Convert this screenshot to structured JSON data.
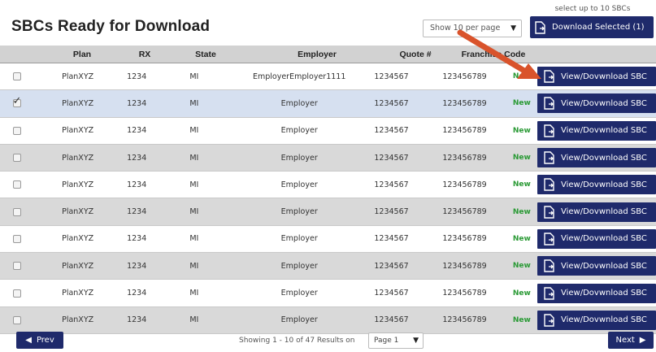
{
  "header": {
    "title": "SBCs Ready for Download",
    "per_page": "Show 10 per page",
    "hint": "select up to 10 SBCs",
    "download_selected": "Download Selected (1)"
  },
  "table": {
    "columns": [
      "Plan",
      "RX",
      "State",
      "Employer",
      "Quote #",
      "Franchise Code"
    ],
    "rows": [
      {
        "checked": false,
        "plan": "PlanXYZ",
        "rx": "1234",
        "state": "MI",
        "employer": "EmployerEmployer1111",
        "quote": "1234567",
        "franchise": "123456789",
        "badge": "New",
        "action": "View/Dovwnload SBC"
      },
      {
        "checked": true,
        "plan": "PlanXYZ",
        "rx": "1234",
        "state": "MI",
        "employer": "Employer",
        "quote": "1234567",
        "franchise": "123456789",
        "badge": "New",
        "action": "View/Dovwnload SBC"
      },
      {
        "checked": false,
        "plan": "PlanXYZ",
        "rx": "1234",
        "state": "MI",
        "employer": "Employer",
        "quote": "1234567",
        "franchise": "123456789",
        "badge": "New",
        "action": "View/Dovwnload SBC"
      },
      {
        "checked": false,
        "plan": "PlanXYZ",
        "rx": "1234",
        "state": "MI",
        "employer": "Employer",
        "quote": "1234567",
        "franchise": "123456789",
        "badge": "New",
        "action": "View/Dovwnload SBC"
      },
      {
        "checked": false,
        "plan": "PlanXYZ",
        "rx": "1234",
        "state": "MI",
        "employer": "Employer",
        "quote": "1234567",
        "franchise": "123456789",
        "badge": "New",
        "action": "View/Dovwnload SBC"
      },
      {
        "checked": false,
        "plan": "PlanXYZ",
        "rx": "1234",
        "state": "MI",
        "employer": "Employer",
        "quote": "1234567",
        "franchise": "123456789",
        "badge": "New",
        "action": "View/Dovwnload SBC"
      },
      {
        "checked": false,
        "plan": "PlanXYZ",
        "rx": "1234",
        "state": "MI",
        "employer": "Employer",
        "quote": "1234567",
        "franchise": "123456789",
        "badge": "New",
        "action": "View/Dovwnload SBC"
      },
      {
        "checked": false,
        "plan": "PlanXYZ",
        "rx": "1234",
        "state": "MI",
        "employer": "Employer",
        "quote": "1234567",
        "franchise": "123456789",
        "badge": "New",
        "action": "View/Dovwnload SBC"
      },
      {
        "checked": false,
        "plan": "PlanXYZ",
        "rx": "1234",
        "state": "MI",
        "employer": "Employer",
        "quote": "1234567",
        "franchise": "123456789",
        "badge": "New",
        "action": "View/Dovwnload SBC"
      },
      {
        "checked": false,
        "plan": "PlanXYZ",
        "rx": "1234",
        "state": "MI",
        "employer": "Employer",
        "quote": "1234567",
        "franchise": "123456789",
        "badge": "New",
        "action": "View/Dovwnload SBC"
      }
    ]
  },
  "footer": {
    "prev": "Prev",
    "next": "Next",
    "status": "Showing 1 - 10 of 47 Results on",
    "page_select": "Page 1"
  },
  "colors": {
    "primary": "#1f2a6b",
    "new_badge": "#2a9a35",
    "annotation_arrow": "#d9532b",
    "row_alt": "#d9d9d9",
    "row_selected": "#d6e0f0"
  },
  "icons": {
    "download": "file-download-icon",
    "prev": "triangle-left-icon",
    "next": "triangle-right-icon",
    "dropdown": "caret-down-icon",
    "annotation": "red-arrow-annotation"
  }
}
